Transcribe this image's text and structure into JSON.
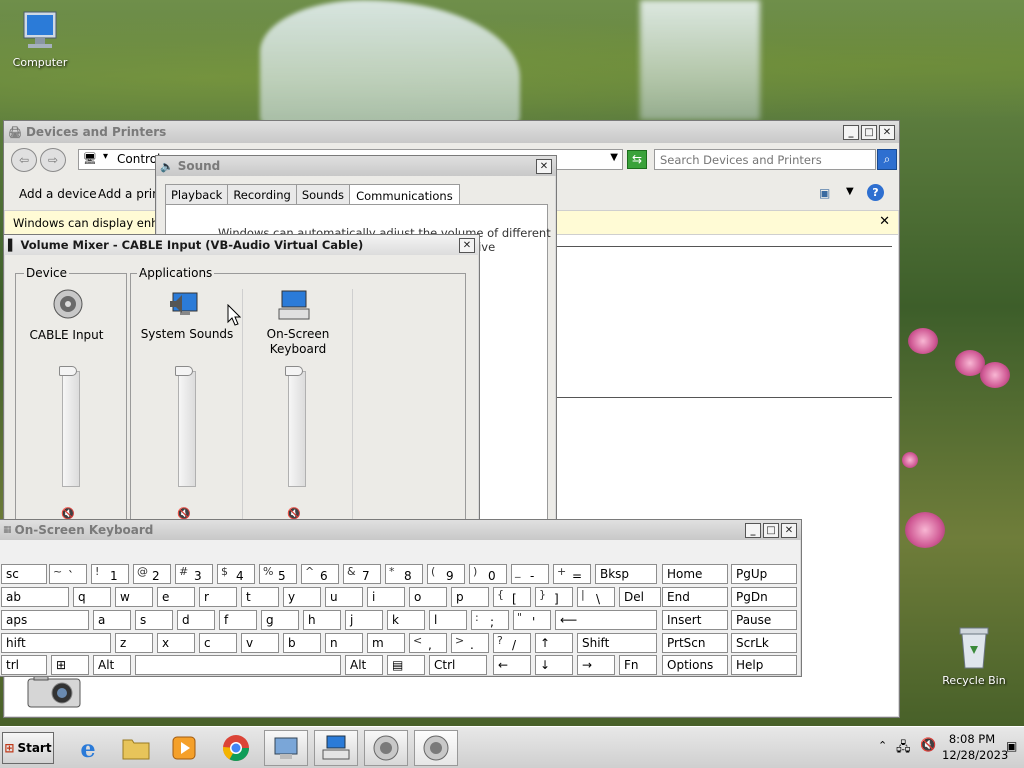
{
  "desktop": {
    "icons": [
      {
        "label": "Computer"
      },
      {
        "label": "Recycle Bin"
      }
    ]
  },
  "devices_window": {
    "title": "Devices and Printers",
    "address_text": "Control",
    "search_placeholder": "Search Devices and Printers",
    "toolbar": {
      "add_device": "Add a device",
      "add_printer": "Add a printe"
    },
    "info_bar": "Windows can display enhance"
  },
  "sound_window": {
    "title": "Sound",
    "tabs": [
      "Playback",
      "Recording",
      "Sounds",
      "Communications"
    ],
    "body_text_1": "Windows can automatically adjust the volume of different",
    "body_text_2": "eive"
  },
  "mixer_window": {
    "title": "Volume Mixer - CABLE Input (VB-Audio Virtual Cable)",
    "device_group": "Device",
    "applications_group": "Applications",
    "channels": [
      {
        "name": "CABLE Input"
      },
      {
        "name": "System Sounds"
      },
      {
        "name": "On-Screen\nKeyboard"
      }
    ]
  },
  "osk_window": {
    "title": "On-Screen Keyboard",
    "rows": [
      [
        {
          "t": "sc"
        },
        {
          "s": "~",
          "m": "`"
        },
        {
          "s": "!",
          "m": "1"
        },
        {
          "s": "@",
          "m": "2"
        },
        {
          "s": "#",
          "m": "3"
        },
        {
          "s": "$",
          "m": "4"
        },
        {
          "s": "%",
          "m": "5"
        },
        {
          "s": "^",
          "m": "6"
        },
        {
          "s": "&",
          "m": "7"
        },
        {
          "s": "*",
          "m": "8"
        },
        {
          "s": "(",
          "m": "9"
        },
        {
          "s": ")",
          "m": "0"
        },
        {
          "s": "_",
          "m": "-"
        },
        {
          "s": "+",
          "m": "="
        },
        {
          "t": "Bksp"
        },
        {
          "t": "Home"
        },
        {
          "t": "PgUp"
        }
      ],
      [
        {
          "t": "ab"
        },
        {
          "t": "q"
        },
        {
          "t": "w"
        },
        {
          "t": "e"
        },
        {
          "t": "r"
        },
        {
          "t": "t"
        },
        {
          "t": "y"
        },
        {
          "t": "u"
        },
        {
          "t": "i"
        },
        {
          "t": "o"
        },
        {
          "t": "p"
        },
        {
          "s": "{",
          "m": "["
        },
        {
          "s": "}",
          "m": "]"
        },
        {
          "s": "|",
          "m": "\\"
        },
        {
          "t": "Del"
        },
        {
          "t": "End"
        },
        {
          "t": "PgDn"
        }
      ],
      [
        {
          "t": "aps"
        },
        {
          "t": "a"
        },
        {
          "t": "s"
        },
        {
          "t": "d"
        },
        {
          "t": "f"
        },
        {
          "t": "g"
        },
        {
          "t": "h"
        },
        {
          "t": "j"
        },
        {
          "t": "k"
        },
        {
          "t": "l"
        },
        {
          "s": ":",
          "m": ";"
        },
        {
          "s": "\"",
          "m": "'"
        },
        {
          "t": "⟵"
        },
        {
          "t": "Insert"
        },
        {
          "t": "Pause"
        }
      ],
      [
        {
          "t": "hift"
        },
        {
          "t": "z"
        },
        {
          "t": "x"
        },
        {
          "t": "c"
        },
        {
          "t": "v"
        },
        {
          "t": "b"
        },
        {
          "t": "n"
        },
        {
          "t": "m"
        },
        {
          "s": "<",
          "m": ","
        },
        {
          "s": ">",
          "m": "."
        },
        {
          "s": "?",
          "m": "/"
        },
        {
          "t": "↑"
        },
        {
          "t": "Shift"
        },
        {
          "t": "PrtScn"
        },
        {
          "t": "ScrLk"
        }
      ],
      [
        {
          "t": "trl"
        },
        {
          "t": "⊞"
        },
        {
          "t": "Alt"
        },
        {
          "t": ""
        },
        {
          "t": "Alt"
        },
        {
          "t": "▤"
        },
        {
          "t": "Ctrl"
        },
        {
          "t": "←"
        },
        {
          "t": "↓"
        },
        {
          "t": "→"
        },
        {
          "t": "Fn"
        },
        {
          "t": "Options"
        },
        {
          "t": "Help"
        }
      ]
    ]
  },
  "taskbar": {
    "start_label": "Start",
    "clock_time": "8:08 PM",
    "clock_date": "12/28/2023"
  }
}
